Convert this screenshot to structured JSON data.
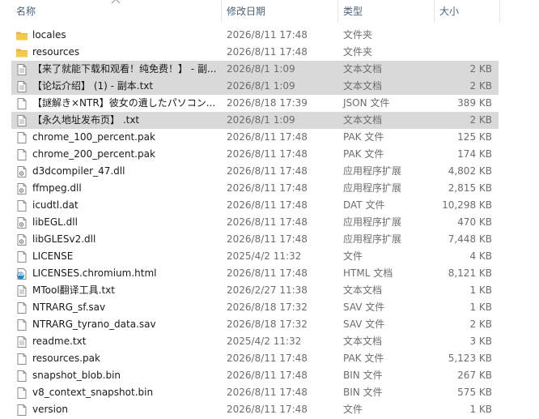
{
  "columns": {
    "name": "名称",
    "modified": "修改日期",
    "type": "类型",
    "size": "大小"
  },
  "files": [
    {
      "name": "locales",
      "modified": "2026/8/11 17:48",
      "type": "文件夹",
      "size": "",
      "icon": "folder-icon",
      "selected": false
    },
    {
      "name": "resources",
      "modified": "2026/8/11 17:48",
      "type": "文件夹",
      "size": "",
      "icon": "folder-icon",
      "selected": false
    },
    {
      "name": "【来了就能下载和观看！纯免费！】 - 副...",
      "modified": "2026/8/1 1:09",
      "type": "文本文档",
      "size": "2 KB",
      "icon": "text-file-icon",
      "selected": true
    },
    {
      "name": "【论坛介绍】 (1) - 副本.txt",
      "modified": "2026/8/1 1:09",
      "type": "文本文档",
      "size": "2 KB",
      "icon": "text-file-icon",
      "selected": true
    },
    {
      "name": "【謎解き×NTR】彼女の遺したパソコン...",
      "modified": "2026/8/18 17:39",
      "type": "JSON 文件",
      "size": "389 KB",
      "icon": "file-icon",
      "selected": false
    },
    {
      "name": "【永久地址发布页】 .txt",
      "modified": "2026/8/1 1:09",
      "type": "文本文档",
      "size": "2 KB",
      "icon": "text-file-icon",
      "selected": true
    },
    {
      "name": "chrome_100_percent.pak",
      "modified": "2026/8/11 17:48",
      "type": "PAK 文件",
      "size": "125 KB",
      "icon": "file-icon",
      "selected": false
    },
    {
      "name": "chrome_200_percent.pak",
      "modified": "2026/8/11 17:48",
      "type": "PAK 文件",
      "size": "174 KB",
      "icon": "file-icon",
      "selected": false
    },
    {
      "name": "d3dcompiler_47.dll",
      "modified": "2026/8/11 17:48",
      "type": "应用程序扩展",
      "size": "4,802 KB",
      "icon": "dll-file-icon",
      "selected": false
    },
    {
      "name": "ffmpeg.dll",
      "modified": "2026/8/11 17:48",
      "type": "应用程序扩展",
      "size": "2,815 KB",
      "icon": "dll-file-icon",
      "selected": false
    },
    {
      "name": "icudtl.dat",
      "modified": "2026/8/11 17:48",
      "type": "DAT 文件",
      "size": "10,298 KB",
      "icon": "file-icon",
      "selected": false
    },
    {
      "name": "libEGL.dll",
      "modified": "2026/8/11 17:48",
      "type": "应用程序扩展",
      "size": "470 KB",
      "icon": "dll-file-icon",
      "selected": false
    },
    {
      "name": "libGLESv2.dll",
      "modified": "2026/8/11 17:48",
      "type": "应用程序扩展",
      "size": "7,448 KB",
      "icon": "dll-file-icon",
      "selected": false
    },
    {
      "name": "LICENSE",
      "modified": "2025/4/2 11:32",
      "type": "文件",
      "size": "4 KB",
      "icon": "file-icon",
      "selected": false
    },
    {
      "name": "LICENSES.chromium.html",
      "modified": "2026/8/11 17:48",
      "type": "HTML 文档",
      "size": "8,121 KB",
      "icon": "edge-html-icon",
      "selected": false
    },
    {
      "name": "MTool翻译工具.txt",
      "modified": "2026/2/27 11:38",
      "type": "文本文档",
      "size": "1 KB",
      "icon": "text-file-icon",
      "selected": false
    },
    {
      "name": "NTRARG_sf.sav",
      "modified": "2026/8/18 17:32",
      "type": "SAV 文件",
      "size": "1 KB",
      "icon": "file-icon",
      "selected": false
    },
    {
      "name": "NTRARG_tyrano_data.sav",
      "modified": "2026/8/18 17:32",
      "type": "SAV 文件",
      "size": "2 KB",
      "icon": "file-icon",
      "selected": false
    },
    {
      "name": "readme.txt",
      "modified": "2025/4/2 11:32",
      "type": "文本文档",
      "size": "3 KB",
      "icon": "text-file-icon",
      "selected": false
    },
    {
      "name": "resources.pak",
      "modified": "2026/8/11 17:48",
      "type": "PAK 文件",
      "size": "5,123 KB",
      "icon": "file-icon",
      "selected": false
    },
    {
      "name": "snapshot_blob.bin",
      "modified": "2026/8/11 17:48",
      "type": "BIN 文件",
      "size": "267 KB",
      "icon": "file-icon",
      "selected": false
    },
    {
      "name": "v8_context_snapshot.bin",
      "modified": "2026/8/11 17:48",
      "type": "BIN 文件",
      "size": "575 KB",
      "icon": "file-icon",
      "selected": false
    },
    {
      "name": "version",
      "modified": "2026/8/11 17:48",
      "type": "文件",
      "size": "1 KB",
      "icon": "file-icon",
      "selected": false
    }
  ],
  "colors": {
    "selected_row": "#d9d9d9",
    "header_text": "#4c607a",
    "folder": "#f6c94d",
    "edge_blue": "#1e88c9"
  }
}
